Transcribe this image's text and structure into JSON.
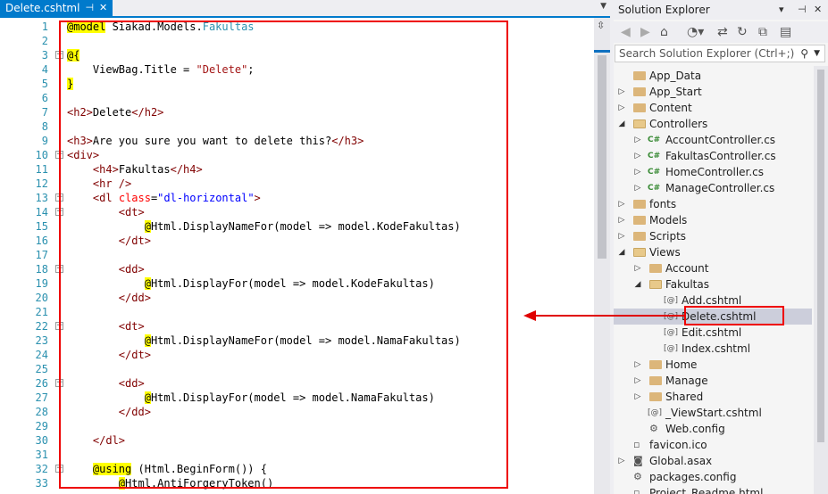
{
  "editor": {
    "tab_label": "Delete.cshtml",
    "tab_pin": "⊣",
    "tab_close": "✕",
    "lines": [
      {
        "n": "1",
        "parts": [
          {
            "t": "@model",
            "c": "razor"
          },
          {
            "t": " Siakad.Models.",
            "c": "plain"
          },
          {
            "t": "Fakultas",
            "c": "type"
          }
        ]
      },
      {
        "n": "2",
        "parts": []
      },
      {
        "n": "3",
        "parts": [
          {
            "t": "@{",
            "c": "razor"
          }
        ]
      },
      {
        "n": "4",
        "parts": [
          {
            "t": "    ViewBag.Title = ",
            "c": "plain"
          },
          {
            "t": "\"Delete\"",
            "c": "strred"
          },
          {
            "t": ";",
            "c": "plain"
          }
        ]
      },
      {
        "n": "5",
        "parts": [
          {
            "t": "}",
            "c": "razor"
          }
        ]
      },
      {
        "n": "6",
        "parts": []
      },
      {
        "n": "7",
        "parts": [
          {
            "t": "<h2>",
            "c": "tag"
          },
          {
            "t": "Delete",
            "c": "plain"
          },
          {
            "t": "</h2>",
            "c": "tag"
          }
        ]
      },
      {
        "n": "8",
        "parts": []
      },
      {
        "n": "9",
        "parts": [
          {
            "t": "<h3>",
            "c": "tag"
          },
          {
            "t": "Are you sure you want to delete this?",
            "c": "plain"
          },
          {
            "t": "</h3>",
            "c": "tag"
          }
        ]
      },
      {
        "n": "10",
        "parts": [
          {
            "t": "<div>",
            "c": "tag"
          }
        ]
      },
      {
        "n": "11",
        "parts": [
          {
            "t": "    ",
            "c": "plain"
          },
          {
            "t": "<h4>",
            "c": "tag"
          },
          {
            "t": "Fakultas",
            "c": "plain"
          },
          {
            "t": "</h4>",
            "c": "tag"
          }
        ]
      },
      {
        "n": "12",
        "parts": [
          {
            "t": "    ",
            "c": "plain"
          },
          {
            "t": "<hr />",
            "c": "tag"
          }
        ]
      },
      {
        "n": "13",
        "parts": [
          {
            "t": "    ",
            "c": "plain"
          },
          {
            "t": "<dl ",
            "c": "tag"
          },
          {
            "t": "class",
            "c": "attr"
          },
          {
            "t": "=",
            "c": "plain"
          },
          {
            "t": "\"dl-horizontal\"",
            "c": "str"
          },
          {
            "t": ">",
            "c": "tag"
          }
        ]
      },
      {
        "n": "14",
        "parts": [
          {
            "t": "        ",
            "c": "plain"
          },
          {
            "t": "<dt>",
            "c": "tag"
          }
        ]
      },
      {
        "n": "15",
        "parts": [
          {
            "t": "            ",
            "c": "plain"
          },
          {
            "t": "@",
            "c": "razor"
          },
          {
            "t": "Html.",
            "c": "plain"
          },
          {
            "t": "DisplayNameFor",
            "c": "plain"
          },
          {
            "t": "(model => model.KodeFakultas)",
            "c": "plain"
          }
        ]
      },
      {
        "n": "16",
        "parts": [
          {
            "t": "        ",
            "c": "plain"
          },
          {
            "t": "</dt>",
            "c": "tag"
          }
        ]
      },
      {
        "n": "17",
        "parts": []
      },
      {
        "n": "18",
        "parts": [
          {
            "t": "        ",
            "c": "plain"
          },
          {
            "t": "<dd>",
            "c": "tag"
          }
        ]
      },
      {
        "n": "19",
        "parts": [
          {
            "t": "            ",
            "c": "plain"
          },
          {
            "t": "@",
            "c": "razor"
          },
          {
            "t": "Html.DisplayFor(model => model.KodeFakultas)",
            "c": "plain"
          }
        ]
      },
      {
        "n": "20",
        "parts": [
          {
            "t": "        ",
            "c": "plain"
          },
          {
            "t": "</dd>",
            "c": "tag"
          }
        ]
      },
      {
        "n": "21",
        "parts": []
      },
      {
        "n": "22",
        "parts": [
          {
            "t": "        ",
            "c": "plain"
          },
          {
            "t": "<dt>",
            "c": "tag"
          }
        ]
      },
      {
        "n": "23",
        "parts": [
          {
            "t": "            ",
            "c": "plain"
          },
          {
            "t": "@",
            "c": "razor"
          },
          {
            "t": "Html.DisplayNameFor(model => model.NamaFakultas)",
            "c": "plain"
          }
        ]
      },
      {
        "n": "24",
        "parts": [
          {
            "t": "        ",
            "c": "plain"
          },
          {
            "t": "</dt>",
            "c": "tag"
          }
        ]
      },
      {
        "n": "25",
        "parts": []
      },
      {
        "n": "26",
        "parts": [
          {
            "t": "        ",
            "c": "plain"
          },
          {
            "t": "<dd>",
            "c": "tag"
          }
        ]
      },
      {
        "n": "27",
        "parts": [
          {
            "t": "            ",
            "c": "plain"
          },
          {
            "t": "@",
            "c": "razor"
          },
          {
            "t": "Html.DisplayFor(model => model.NamaFakultas)",
            "c": "plain"
          }
        ]
      },
      {
        "n": "28",
        "parts": [
          {
            "t": "        ",
            "c": "plain"
          },
          {
            "t": "</dd>",
            "c": "tag"
          }
        ]
      },
      {
        "n": "29",
        "parts": []
      },
      {
        "n": "30",
        "parts": [
          {
            "t": "    ",
            "c": "plain"
          },
          {
            "t": "</dl>",
            "c": "tag"
          }
        ]
      },
      {
        "n": "31",
        "parts": []
      },
      {
        "n": "32",
        "parts": [
          {
            "t": "    ",
            "c": "plain"
          },
          {
            "t": "@using",
            "c": "razor"
          },
          {
            "t": " (Html.BeginForm()) {",
            "c": "plain"
          }
        ]
      },
      {
        "n": "33",
        "parts": [
          {
            "t": "        ",
            "c": "plain"
          },
          {
            "t": "@",
            "c": "razor"
          },
          {
            "t": "Html.AntiForgeryToken()",
            "c": "plain"
          }
        ]
      }
    ]
  },
  "solution_explorer": {
    "title": "Solution Explorer",
    "title_controls": [
      "▾",
      "⊣",
      "✕"
    ],
    "toolbar_icons": [
      "back-icon",
      "forward-icon",
      "home-icon",
      "history-icon",
      "sync-icon",
      "refresh-icon",
      "collapse-all-icon",
      "properties-icon"
    ],
    "search_placeholder": "Search Solution Explorer (Ctrl+;)",
    "tree": [
      {
        "label": "App_Data",
        "indent": 1,
        "kind": "folder",
        "arrow": ""
      },
      {
        "label": "App_Start",
        "indent": 1,
        "kind": "folder",
        "arrow": "▷"
      },
      {
        "label": "Content",
        "indent": 1,
        "kind": "folder",
        "arrow": "▷"
      },
      {
        "label": "Controllers",
        "indent": 1,
        "kind": "folder-open",
        "arrow": "◢"
      },
      {
        "label": "AccountController.cs",
        "indent": 2,
        "kind": "cs",
        "arrow": "▷"
      },
      {
        "label": "FakultasController.cs",
        "indent": 2,
        "kind": "cs",
        "arrow": "▷"
      },
      {
        "label": "HomeController.cs",
        "indent": 2,
        "kind": "cs",
        "arrow": "▷"
      },
      {
        "label": "ManageController.cs",
        "indent": 2,
        "kind": "cs",
        "arrow": "▷"
      },
      {
        "label": "fonts",
        "indent": 1,
        "kind": "folder",
        "arrow": "▷"
      },
      {
        "label": "Models",
        "indent": 1,
        "kind": "folder",
        "arrow": "▷"
      },
      {
        "label": "Scripts",
        "indent": 1,
        "kind": "folder",
        "arrow": "▷"
      },
      {
        "label": "Views",
        "indent": 1,
        "kind": "folder-open",
        "arrow": "◢"
      },
      {
        "label": "Account",
        "indent": 2,
        "kind": "folder",
        "arrow": "▷"
      },
      {
        "label": "Fakultas",
        "indent": 2,
        "kind": "folder-open",
        "arrow": "◢"
      },
      {
        "label": "Add.cshtml",
        "indent": 3,
        "kind": "cshtml",
        "arrow": ""
      },
      {
        "label": "Delete.cshtml",
        "indent": 3,
        "kind": "cshtml",
        "arrow": "",
        "selected": true
      },
      {
        "label": "Edit.cshtml",
        "indent": 3,
        "kind": "cshtml",
        "arrow": ""
      },
      {
        "label": "Index.cshtml",
        "indent": 3,
        "kind": "cshtml",
        "arrow": ""
      },
      {
        "label": "Home",
        "indent": 2,
        "kind": "folder",
        "arrow": "▷"
      },
      {
        "label": "Manage",
        "indent": 2,
        "kind": "folder",
        "arrow": "▷"
      },
      {
        "label": "Shared",
        "indent": 2,
        "kind": "folder",
        "arrow": "▷"
      },
      {
        "label": "_ViewStart.cshtml",
        "indent": 2,
        "kind": "cshtml",
        "arrow": ""
      },
      {
        "label": "Web.config",
        "indent": 2,
        "kind": "config",
        "arrow": ""
      },
      {
        "label": "favicon.ico",
        "indent": 1,
        "kind": "file",
        "arrow": ""
      },
      {
        "label": "Global.asax",
        "indent": 1,
        "kind": "asax",
        "arrow": "▷"
      },
      {
        "label": "packages.config",
        "indent": 1,
        "kind": "config",
        "arrow": ""
      },
      {
        "label": "Project_Readme.html",
        "indent": 1,
        "kind": "file",
        "arrow": ""
      }
    ]
  },
  "colors": {
    "accent": "#007acc",
    "highlight": "#e00000",
    "selection": "#cccedb"
  }
}
